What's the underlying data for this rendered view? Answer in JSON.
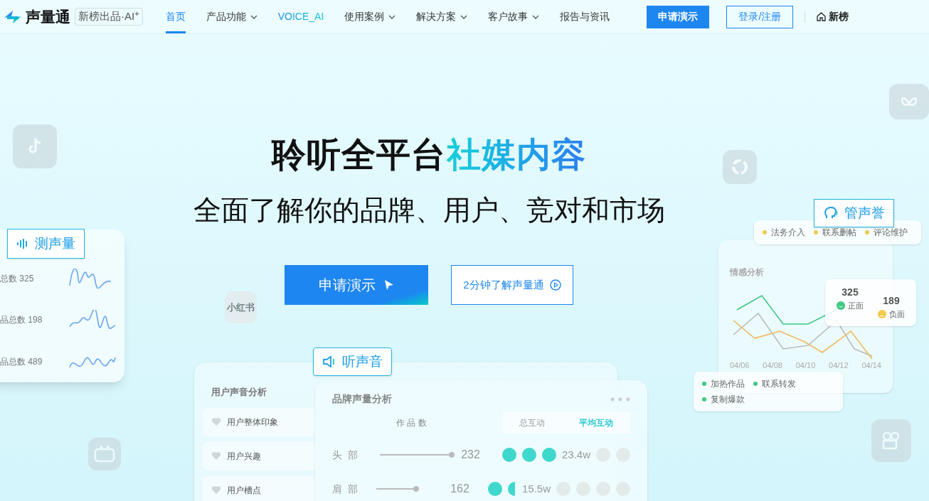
{
  "brand": {
    "name": "声量通",
    "badge": "新榜出品·AI$^{+}$"
  },
  "nav": [
    {
      "label": "首页",
      "selected": true,
      "dropdown": false,
      "kind": "plain"
    },
    {
      "label": "产品功能",
      "selected": false,
      "dropdown": true,
      "kind": "plain"
    },
    {
      "label": "VOICE_AI",
      "selected": false,
      "dropdown": false,
      "kind": "gradient"
    },
    {
      "label": "使用案例",
      "selected": false,
      "dropdown": true,
      "kind": "plain"
    },
    {
      "label": "解决方案",
      "selected": false,
      "dropdown": true,
      "kind": "plain"
    },
    {
      "label": "客户故事",
      "selected": false,
      "dropdown": true,
      "kind": "plain"
    },
    {
      "label": "报告与资讯",
      "selected": false,
      "dropdown": false,
      "kind": "plain"
    }
  ],
  "nav_actions": {
    "demo": "申请演示",
    "login": "登录/注册",
    "home": "新榜"
  },
  "hero": {
    "title": "聆听全平台",
    "title_highlight": "社媒内容",
    "subtitle": "全面了解你的品牌、用户、竞对和市场",
    "primary_button": "申请演示",
    "secondary_button": "2分钟了解声量通"
  },
  "platform_tiles": [
    {
      "kind": "tiktok"
    },
    {
      "kind": "butterfly"
    },
    {
      "kind": "ring"
    },
    {
      "kind": "text",
      "label": "小红书"
    },
    {
      "kind": "tv"
    },
    {
      "kind": "camera"
    }
  ],
  "volume_card": {
    "callout": "测声量",
    "rows": [
      {
        "label": "总数 325"
      },
      {
        "label": "品总数 198"
      },
      {
        "label": "品总数 489"
      }
    ]
  },
  "reputation_card": {
    "callout": "管声誉",
    "top_tags": [
      {
        "label": "法务介入",
        "color": "#f2c94c"
      },
      {
        "label": "联系删帖",
        "color": "#f2c94c"
      },
      {
        "label": "评论维护",
        "color": "#f2c94c"
      }
    ],
    "chart_title": "情感分析",
    "dates": [
      "04/06",
      "04/08",
      "04/10",
      "04/12",
      "04/14"
    ],
    "positive": {
      "value": "325",
      "label": "正面"
    },
    "negative": {
      "value": "189",
      "label": "负面"
    },
    "bottom_tags": [
      {
        "label": "加热作品",
        "color": "#3ec97f"
      },
      {
        "label": "联系转发",
        "color": "#3ec97f"
      },
      {
        "label": "复制爆款",
        "color": "#3ec97f"
      }
    ]
  },
  "listen_card": {
    "callout": "听声音",
    "side_title": "用户声音分析",
    "side_items": [
      {
        "label": "用户整体印象"
      },
      {
        "label": "用户兴趣"
      },
      {
        "label": "用户槽点"
      }
    ],
    "title": "品牌声量分析",
    "column": "作 品 数",
    "tabs": [
      {
        "label": "总互动",
        "selected": false
      },
      {
        "label": "平均互动",
        "selected": true
      }
    ],
    "rows": [
      {
        "label": "头  部",
        "count": "232",
        "value": "23.4w",
        "dots": [
          {
            "kind": "full"
          },
          {
            "kind": "full"
          },
          {
            "kind": "full"
          },
          {
            "kind": "empty"
          },
          {
            "kind": "empty"
          }
        ]
      },
      {
        "label": "肩  部",
        "count": "162",
        "value": "15.5w",
        "dots": [
          {
            "kind": "full"
          },
          {
            "kind": "half"
          },
          {
            "kind": "empty"
          },
          {
            "kind": "empty"
          },
          {
            "kind": "empty"
          },
          {
            "kind": "empty"
          }
        ]
      }
    ]
  }
}
